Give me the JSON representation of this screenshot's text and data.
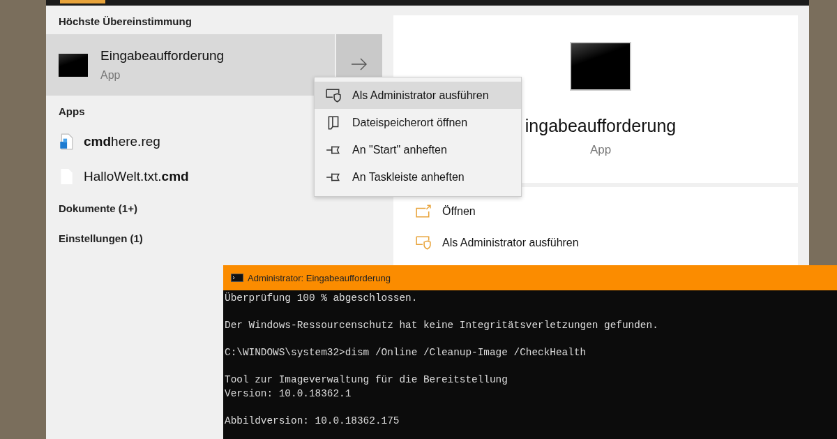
{
  "best_match": {
    "header": "Höchste Übereinstimmung",
    "title": "Eingabeaufforderung",
    "subtitle": "App",
    "selected": true
  },
  "apps": {
    "header": "Apps",
    "items": [
      {
        "name": "**cmd**here.reg",
        "kind": "reg"
      },
      {
        "name": "HalloWelt.txt.**cmd**",
        "kind": "file"
      }
    ]
  },
  "categories": [
    "Dokumente (1+)",
    "Einstellungen (1)"
  ],
  "context_menu": [
    {
      "label": "Als Administrator ausführen",
      "kind": "shield",
      "selected": true
    },
    {
      "label": "Dateispeicherort öffnen",
      "kind": "folder",
      "selected": false
    },
    {
      "label": "An \"Start\" anheften",
      "kind": "pin",
      "selected": false
    },
    {
      "label": "An Taskleiste anheften",
      "kind": "pin",
      "selected": false
    }
  ],
  "details": {
    "title": "ingabeaufforderung",
    "subtitle": "App",
    "actions": [
      {
        "label": "Öffnen",
        "kind": "open"
      },
      {
        "label": "Als Administrator ausführen",
        "kind": "shield"
      }
    ]
  },
  "console": {
    "title": "Administrator: Eingabeaufforderung",
    "blocks": [
      [
        "Überprüfung 100 % abgeschlossen."
      ],
      [
        "Der Windows-Ressourcenschutz hat keine Integritätsverletzungen gefunden."
      ],
      [
        "C:\\WINDOWS\\system32>dism /Online /Cleanup-Image /CheckHealth"
      ],
      [
        "Tool zur Imageverwaltung für die Bereitstellung",
        "Version: 10.0.18362.1"
      ],
      [
        "Abbildversion: 10.0.18362.175"
      ]
    ]
  }
}
